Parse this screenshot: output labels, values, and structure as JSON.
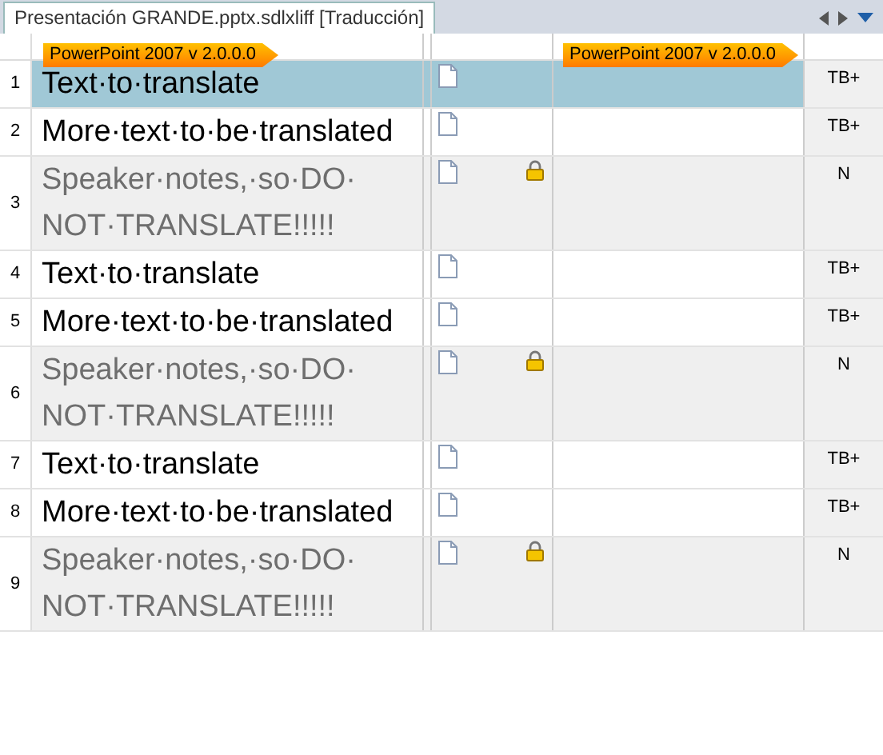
{
  "tab": {
    "title": "Presentación GRANDE.pptx.sdlxliff [Traducción]",
    "selected": true
  },
  "source_tag": "PowerPoint 2007 v 2.0.0.0",
  "target_tag": "PowerPoint 2007 v 2.0.0.0",
  "segments": [
    {
      "number": "1",
      "source": "Text·to·translate",
      "locked": false,
      "selected": true,
      "match": "TB+"
    },
    {
      "number": "2",
      "source": "More·text·to·be·translated",
      "locked": false,
      "selected": false,
      "match": "TB+"
    },
    {
      "number": "3",
      "source": "Speaker·notes,·so·DO·NOT·TRANSLATE!!!!!",
      "locked": true,
      "selected": false,
      "match": "N"
    },
    {
      "number": "4",
      "source": "Text·to·translate",
      "locked": false,
      "selected": false,
      "match": "TB+"
    },
    {
      "number": "5",
      "source": "More·text·to·be·translated",
      "locked": false,
      "selected": false,
      "match": "TB+"
    },
    {
      "number": "6",
      "source": "Speaker·notes,·so·DO·NOT·TRANSLATE!!!!!",
      "locked": true,
      "selected": false,
      "match": "N"
    },
    {
      "number": "7",
      "source": "Text·to·translate",
      "locked": false,
      "selected": false,
      "match": "TB+"
    },
    {
      "number": "8",
      "source": "More·text·to·be·translated",
      "locked": false,
      "selected": false,
      "match": "TB+"
    },
    {
      "number": "9",
      "source": "Speaker·notes,·so·DO·NOT·TRANSLATE!!!!!",
      "locked": true,
      "selected": false,
      "match": "N"
    }
  ]
}
